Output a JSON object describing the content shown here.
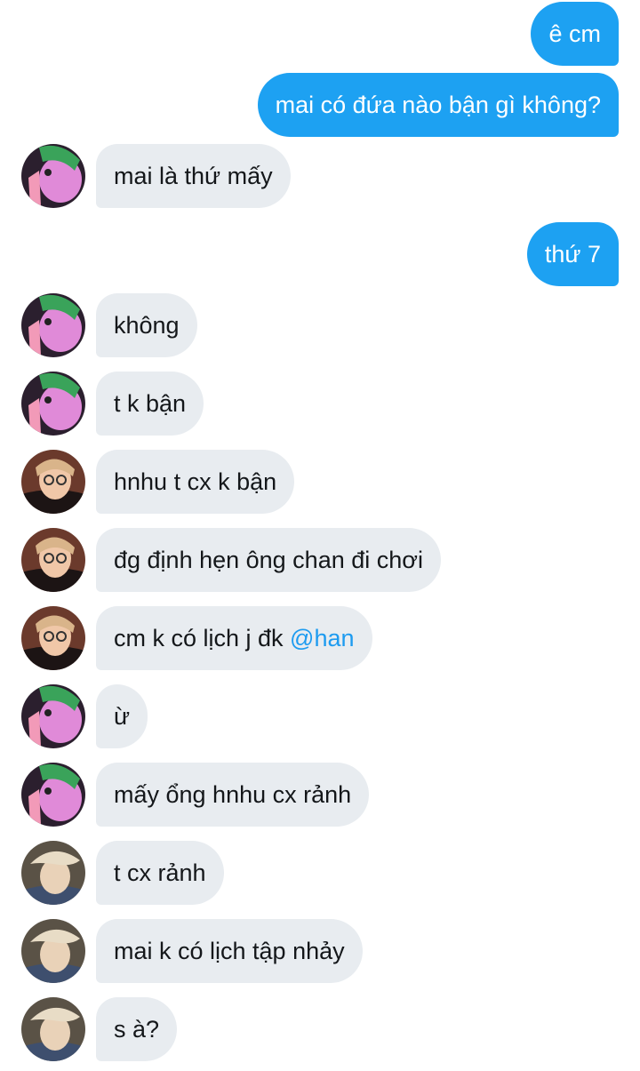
{
  "colors": {
    "outgoing_bubble": "#1da1f2",
    "incoming_bubble": "#e8ecf0",
    "mention": "#1d9bf0"
  },
  "messages": [
    {
      "direction": "out",
      "text": "ê cm"
    },
    {
      "direction": "out",
      "text": "mai có đứa nào bận gì không?"
    },
    {
      "direction": "in",
      "avatar": "avatar-green-hair-icon",
      "text": "mai là thứ mấy"
    },
    {
      "direction": "out",
      "text": "thứ 7"
    },
    {
      "direction": "in",
      "avatar": "avatar-green-hair-icon",
      "text": "không"
    },
    {
      "direction": "in",
      "avatar": "avatar-green-hair-icon",
      "text": "t k bận"
    },
    {
      "direction": "in",
      "avatar": "avatar-glasses-icon",
      "text": "hnhu t cx k bận"
    },
    {
      "direction": "in",
      "avatar": "avatar-glasses-icon",
      "text": "đg định hẹn ông chan đi chơi"
    },
    {
      "direction": "in",
      "avatar": "avatar-glasses-icon",
      "text": "cm k có lịch j đk ",
      "mention": "@han"
    },
    {
      "direction": "in",
      "avatar": "avatar-green-hair-icon",
      "text": "ừ"
    },
    {
      "direction": "in",
      "avatar": "avatar-green-hair-icon",
      "text": "mấy ổng hnhu cx rảnh"
    },
    {
      "direction": "in",
      "avatar": "avatar-beret-icon",
      "text": "t cx rảnh"
    },
    {
      "direction": "in",
      "avatar": "avatar-beret-icon",
      "text": "mai k có lịch tập nhảy"
    },
    {
      "direction": "in",
      "avatar": "avatar-beret-icon",
      "text": "s à?"
    }
  ]
}
